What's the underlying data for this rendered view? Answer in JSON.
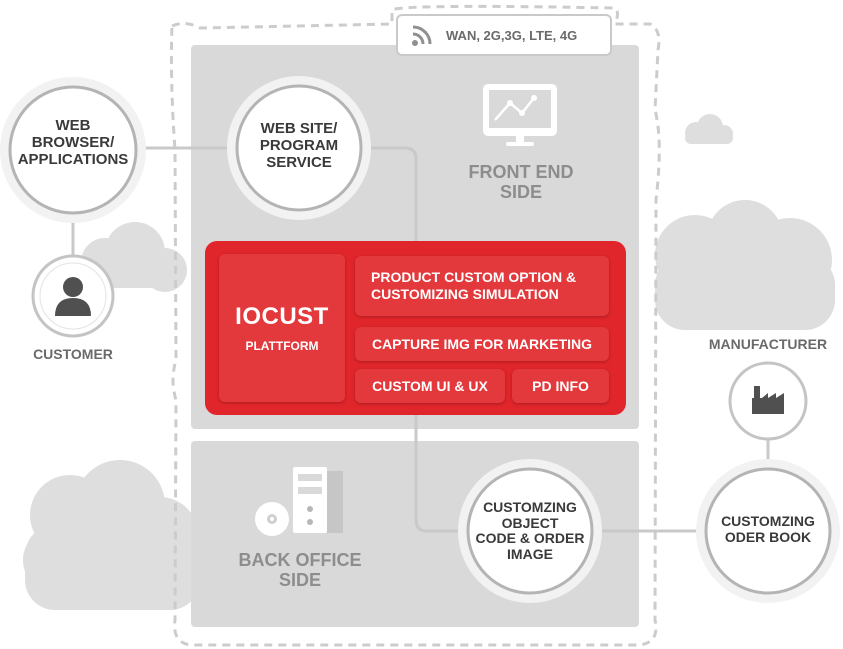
{
  "network": {
    "label": "WAN, 2G,3G, LTE, 4G",
    "icon": "wifi-icon"
  },
  "nodes": {
    "web_browser": "WEB\nBROWSER/\nAPPLICATIONS",
    "customer": "CUSTOMER",
    "web_site": "WEB SITE/\nPROGRAM\nSERVICE",
    "front_end": "FRONT END\nSIDE",
    "back_office": "BACK OFFICE\nSIDE",
    "manufacturer": "MANUFACTURER",
    "customizing_object": "CUSTOMZING\nOBJECT\nCODE & ORDER\nIMAGE",
    "order_book": "CUSTOMZING\nODER BOOK"
  },
  "platform": {
    "title": "IOCUST",
    "subtitle": "PLATTFORM",
    "modules": {
      "custom_option": "PRODUCT CUSTOM OPTION &\nCUSTOMIZING SIMULATION",
      "capture_img": "CAPTURE IMG FOR MARKETING",
      "custom_ui": "CUSTOM UI & UX",
      "pd_info": "PD INFO"
    }
  },
  "colors": {
    "accent": "#e1262b",
    "panel": "#d9d9d9",
    "line": "#cfcfcf",
    "cloud": "#dedede",
    "text_dark": "#3a3a3a",
    "text_gray": "#8d8d8d"
  },
  "icons": [
    "monitor-chart-icon",
    "user-icon",
    "factory-icon",
    "server-icon",
    "disc-icon",
    "cloud-icon"
  ]
}
